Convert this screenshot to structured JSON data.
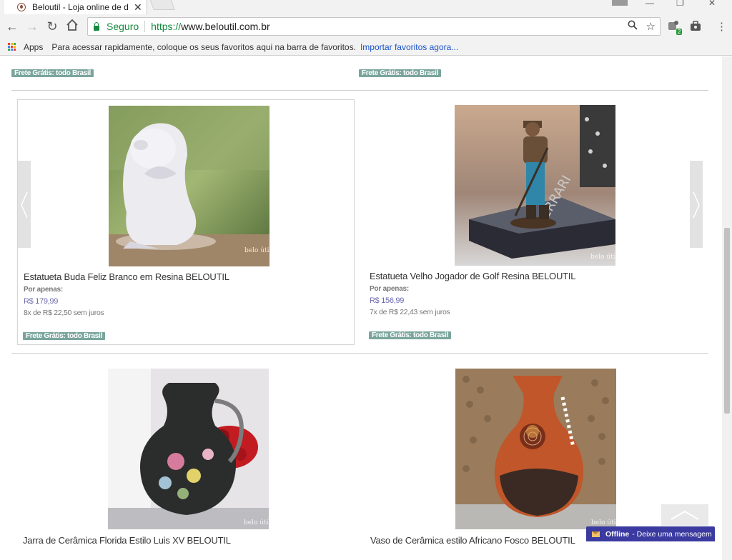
{
  "browser": {
    "tab_title": "Beloutil - Loja online de d",
    "tab_close": "✕",
    "secure_label": "Seguro",
    "url_scheme": "https://",
    "url_rest": "www.beloutil.com.br",
    "extension_badge": "2",
    "icons": [
      "back-icon",
      "forward-icon",
      "reload-icon",
      "home-icon",
      "zoom-icon",
      "star-icon",
      "extension-icon",
      "briefcase-icon",
      "menu-icon"
    ]
  },
  "bookmarks": {
    "apps_label": "Apps",
    "hint": "Para acessar rapidamente, coloque os seus favoritos aqui na barra de favoritos.",
    "import_link": "Importar favoritos agora..."
  },
  "top_badges": [
    "Frete Grátis: todo Brasil",
    "Frete Grátis: todo Brasil"
  ],
  "carousel": {
    "products": [
      {
        "name": "Estatueta Buda Feliz Branco em Resina BELOUTIL",
        "label": "Por apenas:",
        "price": "R$ 179,99",
        "installments": "8x de R$ 22,50 sem juros",
        "badge": "Frete Grátis: todo Brasil"
      },
      {
        "name": "Estatueta Velho Jogador de Golf Resina BELOUTIL",
        "label": "Por apenas:",
        "price": "R$ 156,99",
        "installments": "7x de R$ 22,43 sem juros",
        "badge": "Frete Grátis: todo Brasil"
      }
    ],
    "watermark": "belo útil"
  },
  "bottom_products": [
    {
      "name": "Jarra de Cerâmica Florida Estilo Luis XV BELOUTIL"
    },
    {
      "name": "Vaso de Cerâmica estilo Africano Fosco BELOUTIL"
    }
  ],
  "chat": {
    "status": "Offline",
    "message": "- Deixe uma mensagem"
  },
  "colors": {
    "badge": "#7aa59d",
    "price": "#6c6cb0",
    "chat": "#3a3aa0",
    "secure": "#148a3e",
    "link": "#1a55c9"
  }
}
